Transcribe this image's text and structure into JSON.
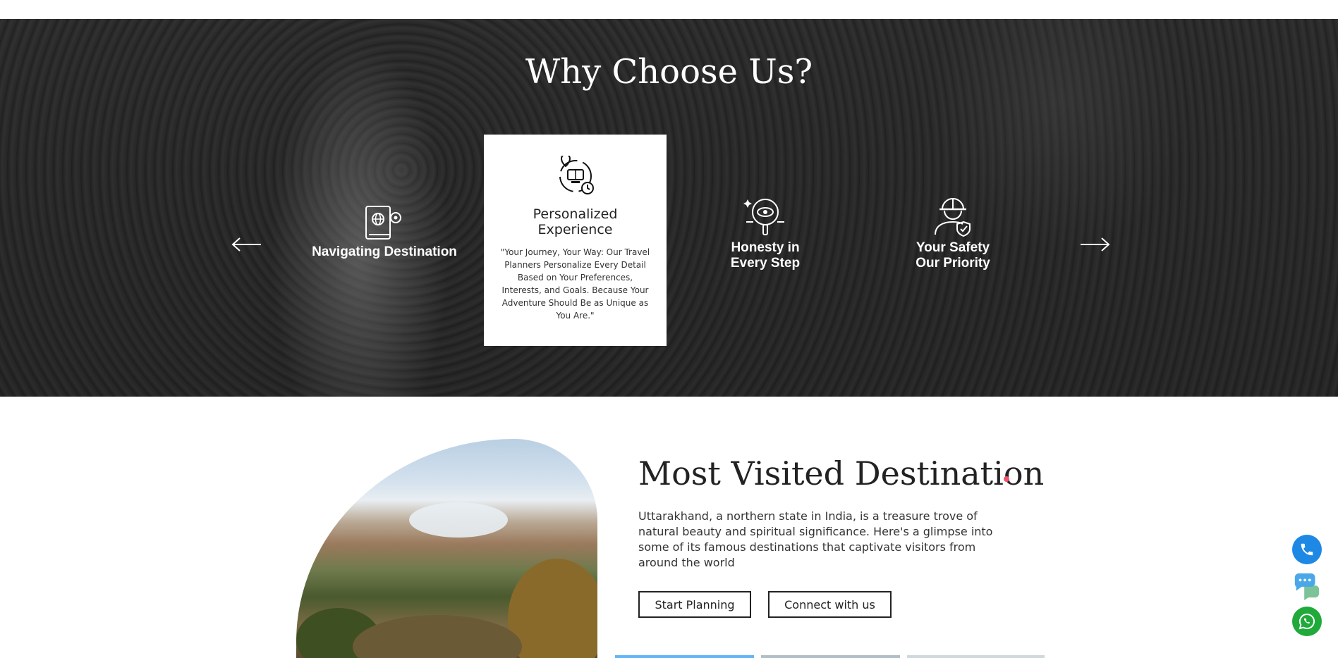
{
  "why_section": {
    "title": "Why Choose Us?",
    "features": [
      {
        "label": "Navigating Destination",
        "icon": "book-globe-gear-icon"
      },
      {
        "label": "Personalized Experience",
        "icon": "travel-planner-icon",
        "description": "\"Your Journey, Your Way: Our Travel Planners Personalize Every Detail Based on Your Preferences, Interests, and Goals. Because Your Adventure Should Be as Unique as You Are.\""
      },
      {
        "label_line1": "Honesty in",
        "label_line2": "Every Step",
        "icon": "eye-magnifier-icon"
      },
      {
        "label_line1": "Your Safety",
        "label_line2": "Our Priority",
        "icon": "safety-helmet-shield-icon"
      }
    ],
    "prev_icon": "arrow-left-icon",
    "next_icon": "arrow-right-icon"
  },
  "destination_section": {
    "title": "Most Visited Destination",
    "description": "Uttarakhand, a northern state in India, is a treasure trove of natural beauty and spiritual significance. Here's a glimpse into some of its famous destinations that captivate visitors from around the world",
    "buttons": {
      "start": "Start Planning",
      "connect": "Connect with us"
    }
  },
  "floating_actions": [
    {
      "icon": "phone-icon",
      "color": "#1e88e5"
    },
    {
      "icon": "chat-icon",
      "color": "#4aa8e8"
    },
    {
      "icon": "whatsapp-icon",
      "color": "#1faa3a"
    }
  ],
  "colors": {
    "accent_dot": "#f0556a",
    "tab_active": "#64b5f6",
    "tab_inactive": "#b0bec5"
  }
}
